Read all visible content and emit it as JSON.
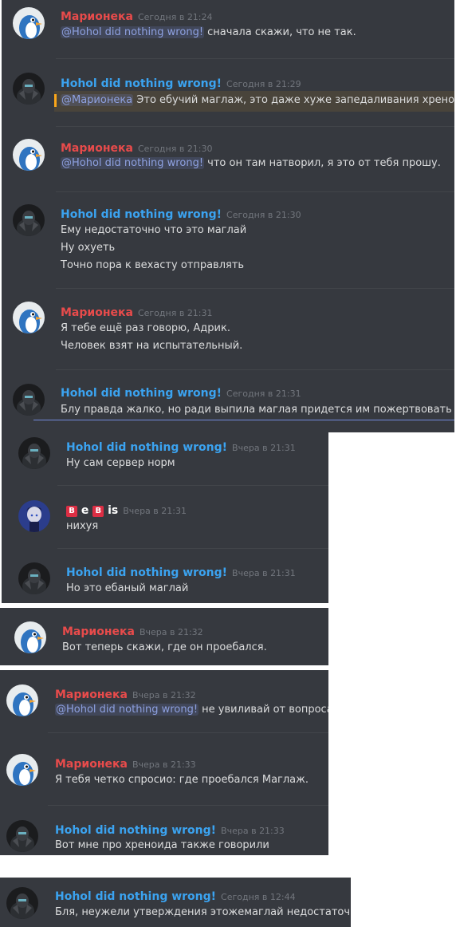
{
  "labels": {
    "today": "Сегодня в",
    "yesterday": "Вчера в"
  },
  "users": {
    "hohol": "Hohol did nothing wrong!",
    "marioneka": "Марионека",
    "bebis": {
      "p1": "B",
      "p2": "e",
      "p3": "B",
      "p4": "is"
    }
  },
  "colors": {
    "hohol": "#3ba3f0",
    "marioneka": "#e84b4b",
    "mention": "#8ea1e1",
    "background": "#36393f"
  },
  "icons": {
    "marioneka": "blue-penguin-avatar-icon",
    "hohol": "dark-armored-figure-avatar-icon",
    "bebis": "anime-character-avatar-icon"
  },
  "s1": {
    "m1": {
      "time": "21:24",
      "mention": "@Hohol did nothing wrong!",
      "text": " сначала скажи, что не так."
    },
    "m2": {
      "time": "21:29",
      "mention": "@Марионека",
      "text": "  Это ебучий маглаж, это даже хуже запедаливания хреноида"
    },
    "m3": {
      "time": "21:30",
      "mention": "@Hohol did nothing wrong!",
      "text": " что он там натворил, я это от тебя прошу."
    },
    "m4": {
      "time": "21:30",
      "l1": "Ему недостаточно что это маглай",
      "l2": "Ну охуеть",
      "l3": "Точно пора к вехасту отправлять"
    },
    "m5": {
      "time": "21:31",
      "l1": "Я тебе ещё раз говорю, Адрик.",
      "l2": "Человек взят на испытательный."
    },
    "m6": {
      "time": "21:31",
      "l1": "Блу правда жалко, но ради выпила маглая придется им пожертвовать"
    }
  },
  "s2": {
    "m1": {
      "time": "21:31",
      "l1": "Ну сам сервер норм"
    },
    "m2": {
      "time": "21:31",
      "l1": "нихуя"
    },
    "m3": {
      "time": "21:31",
      "l1": "Но это ебаный маглай"
    }
  },
  "s3": {
    "m1": {
      "time": "21:32",
      "l1": "Вот теперь скажи, где он проебался."
    }
  },
  "s4": {
    "m1": {
      "time": "21:32",
      "mention": "@Hohol did nothing wrong!",
      "text": " не увиливай от вопроса."
    },
    "m2": {
      "time": "21:33",
      "l1": "Я тебя четко спросио: где проебался Маглаж."
    },
    "m3": {
      "time": "21:33",
      "l1": "Вот мне про хреноида также говорили"
    }
  },
  "s5": {
    "m1": {
      "time": "12:44",
      "l1": "Бля, неужели утверждения этожемаглай недостаточно"
    }
  }
}
